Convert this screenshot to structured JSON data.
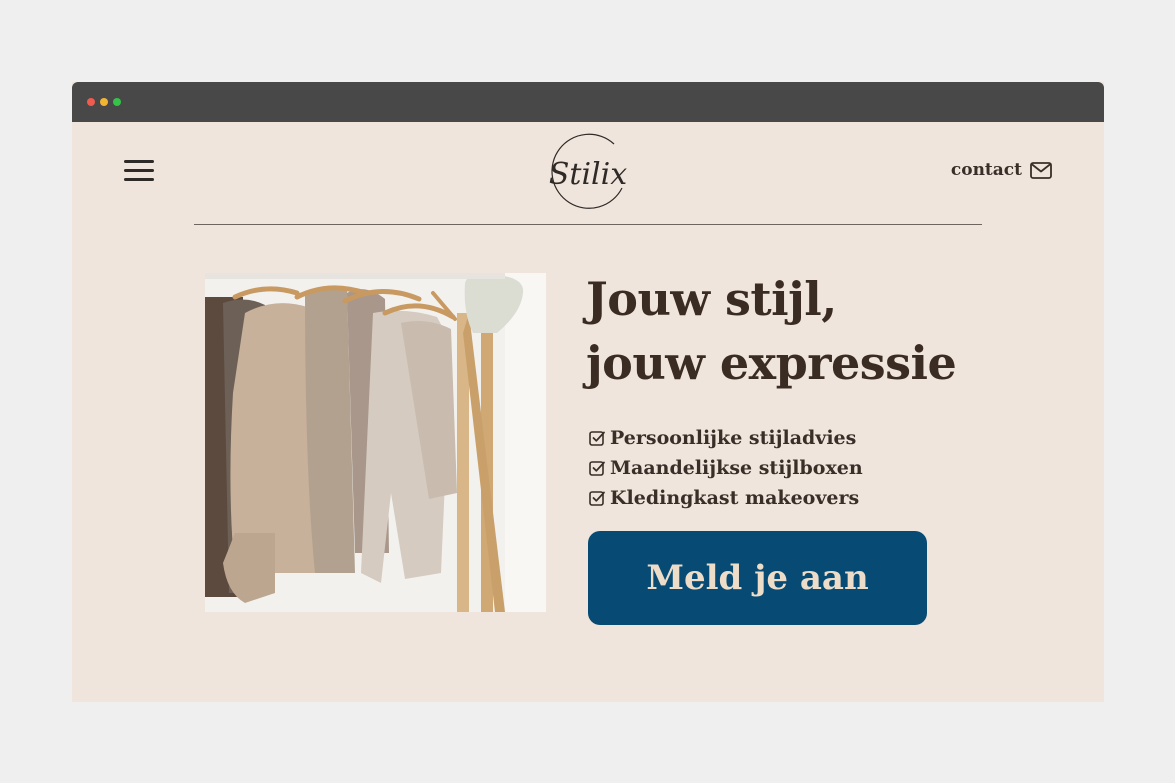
{
  "window": {
    "controls": [
      "close",
      "minimize",
      "maximize"
    ],
    "colors": {
      "close": "#ee5b4f",
      "minimize": "#f2b533",
      "maximize": "#35c447",
      "titlebar": "#484848"
    }
  },
  "header": {
    "menu_icon": "hamburger-menu-icon",
    "logo_text": "Stilix",
    "contact_label": "contact",
    "contact_icon": "envelope-icon"
  },
  "hero": {
    "image_alt": "Kledingrek met beige en bruine kleding op houten hangers",
    "headline_line1": "Jouw stijl,",
    "headline_line2": "jouw expressie",
    "features": [
      {
        "icon": "checkbox-checked-icon",
        "label": "Persoonlijke stijladvies"
      },
      {
        "icon": "checkbox-checked-icon",
        "label": "Maandelijkse stijlboxen"
      },
      {
        "icon": "checkbox-checked-icon",
        "label": "Kledingkast makeovers"
      }
    ],
    "cta_label": "Meld je aan"
  },
  "colors": {
    "page_background": "#efe5dc",
    "text": "#3b2c23",
    "cta_background": "#074b74",
    "cta_text": "#ecdcc8"
  }
}
